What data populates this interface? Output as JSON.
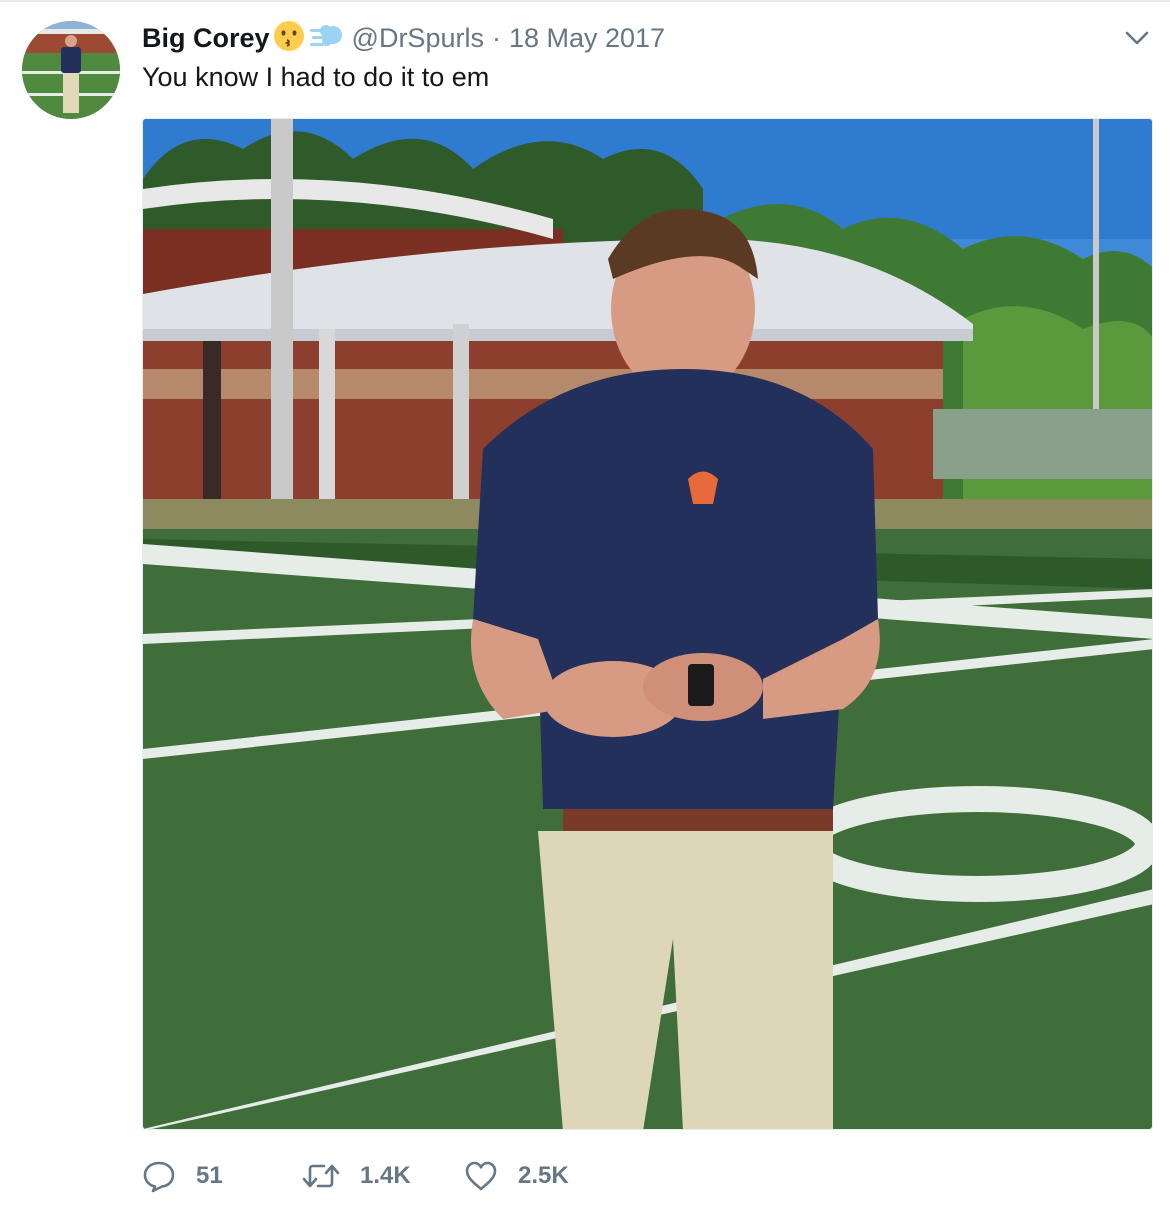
{
  "tweet": {
    "author_name": "Big Corey",
    "author_emoji": [
      "kissing-face-emoji",
      "dash-emoji"
    ],
    "handle": "@DrSpurls",
    "separator": "·",
    "date": "18 May 2017",
    "text": "You know I had to do it to em"
  },
  "actions": {
    "reply_count": "51",
    "retweet_count": "1.4K",
    "like_count": "2.5K"
  },
  "icons": {
    "menu": "chevron-down-icon",
    "reply": "reply-icon",
    "retweet": "retweet-icon",
    "like": "heart-icon"
  },
  "colors": {
    "text_primary": "#14171a",
    "text_secondary": "#657786",
    "divider": "#e6ecf0"
  }
}
